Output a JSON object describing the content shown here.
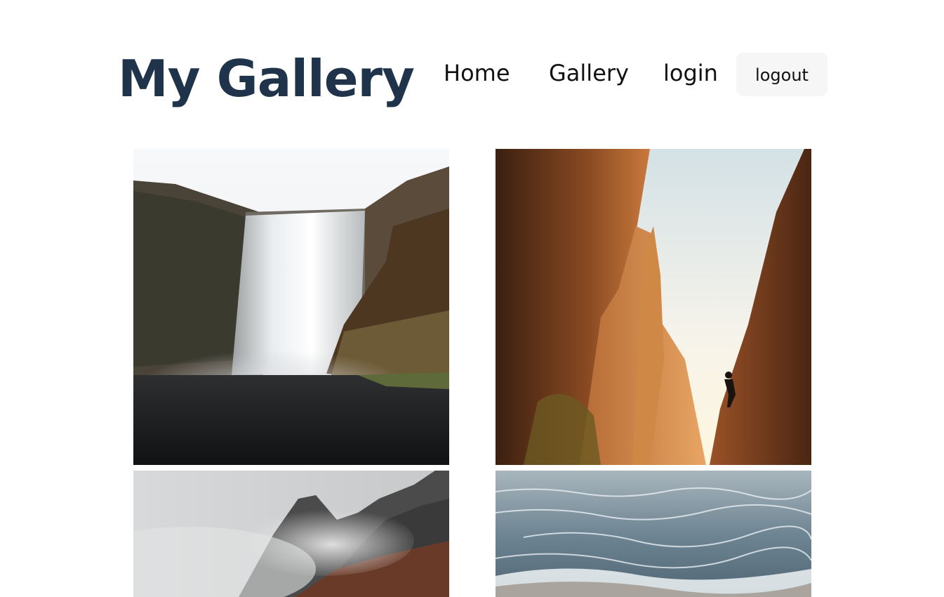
{
  "header": {
    "title": "My Gallery"
  },
  "nav": {
    "home": "Home",
    "gallery": "Gallery",
    "login": "login",
    "logout": "logout"
  },
  "gallery": {
    "photos": [
      {
        "subject": "waterfall"
      },
      {
        "subject": "canyon-climber"
      },
      {
        "subject": "misty-mountains"
      },
      {
        "subject": "ocean-waves"
      }
    ]
  },
  "colors": {
    "title": "#1f344b",
    "nav_text": "#111111",
    "button_bg": "#f6f6f6",
    "page_bg": "#ffffff"
  }
}
